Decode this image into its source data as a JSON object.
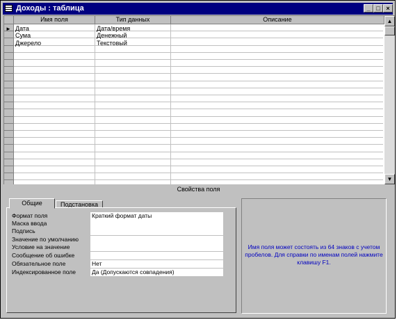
{
  "window": {
    "title": "Доходы : таблица",
    "icon": "table-icon"
  },
  "title_buttons": {
    "minimize": "_",
    "maximize": "□",
    "close": "×"
  },
  "grid": {
    "columns": [
      "Имя поля",
      "Тип данных",
      "Описание"
    ],
    "current_row_marker": "►",
    "rows": [
      {
        "name": "Дата",
        "type": "Дата/время",
        "description": ""
      },
      {
        "name": "Сума",
        "type": "Денежный",
        "description": ""
      },
      {
        "name": "Джерело",
        "type": "Текстовый",
        "description": ""
      }
    ]
  },
  "scrollbar": {
    "up": "▲",
    "down": "▼"
  },
  "properties": {
    "title": "Свойства поля",
    "tabs": [
      "Общие",
      "Подстановка"
    ],
    "active_tab": "Общие",
    "fields": [
      {
        "label": "Формат поля",
        "value": "Краткий формат даты"
      },
      {
        "label": "Маска ввода",
        "value": ""
      },
      {
        "label": "Подпись",
        "value": ""
      },
      {
        "label": "Значение по умолчанию",
        "value": ""
      },
      {
        "label": "Условие на значение",
        "value": ""
      },
      {
        "label": "Сообщение об ошибке",
        "value": ""
      },
      {
        "label": "Обязательное поле",
        "value": "Нет"
      },
      {
        "label": "Индексированное поле",
        "value": "Да (Допускаются совпадения)"
      }
    ],
    "hint": "Имя поля может состоять из 64 знаков с учетом пробелов.  Для справки по именам полей нажмите клавишу F1.",
    "hint_color": "#0000c0"
  }
}
